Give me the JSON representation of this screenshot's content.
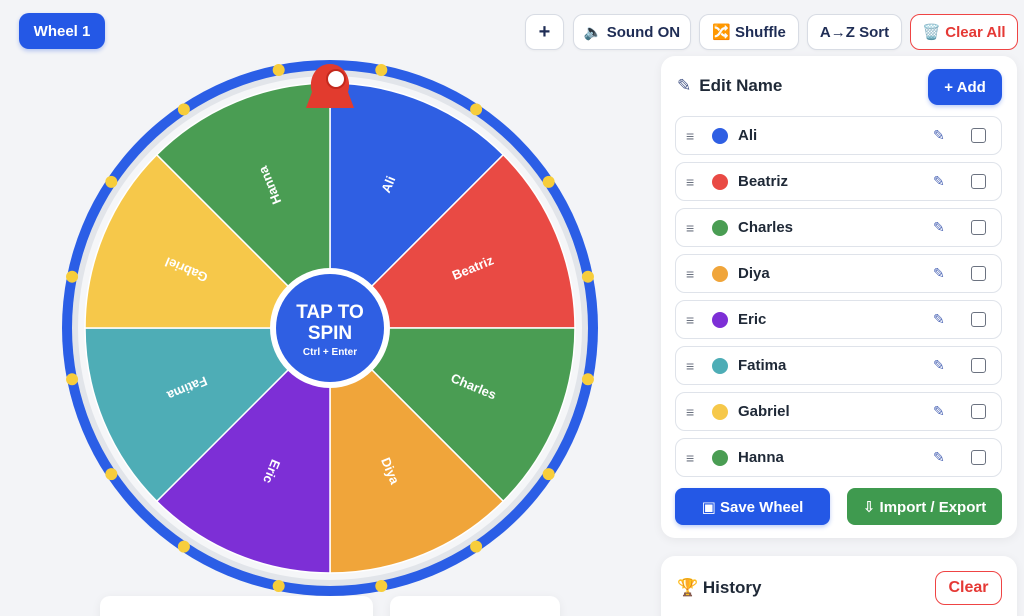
{
  "header": {
    "wheel_tab": "Wheel 1",
    "plus": "+",
    "sound": "🔈 Sound ON",
    "shuffle": "🔀 Shuffle",
    "sort": "A→Z Sort",
    "clear_all": "🗑️ Clear All"
  },
  "wheel": {
    "spin_title_1": "TAP TO",
    "spin_title_2": "SPIN",
    "spin_shortcut": "Ctrl + Enter",
    "segments": [
      {
        "label": "Ali",
        "color": "#2f5fe3"
      },
      {
        "label": "Beatriz",
        "color": "#e94a44"
      },
      {
        "label": "Charles",
        "color": "#4a9d53"
      },
      {
        "label": "Diya",
        "color": "#f0a53a"
      },
      {
        "label": "Eric",
        "color": "#7d2fd6"
      },
      {
        "label": "Fatima",
        "color": "#4eadb6"
      },
      {
        "label": "Gabriel",
        "color": "#f6c84a"
      },
      {
        "label": "Hanna",
        "color": "#4a9d53"
      }
    ],
    "rim_color": "#2b5ee6",
    "rim_dot_color": "#f7cd3b",
    "pointer_color": "#e23b2e"
  },
  "edit_panel": {
    "title": "Edit Name",
    "pencil_icon": "✎",
    "add_label": "+ Add",
    "rows": [
      {
        "name": "Ali",
        "color": "#2f5fe3"
      },
      {
        "name": "Beatriz",
        "color": "#e94a44"
      },
      {
        "name": "Charles",
        "color": "#4a9d53"
      },
      {
        "name": "Diya",
        "color": "#f0a53a"
      },
      {
        "name": "Eric",
        "color": "#7d2fd6"
      },
      {
        "name": "Fatima",
        "color": "#4eadb6"
      },
      {
        "name": "Gabriel",
        "color": "#f6c84a"
      },
      {
        "name": "Hanna",
        "color": "#4a9d53"
      }
    ],
    "drag_glyph": "≡",
    "edit_glyph": "✎",
    "save_label": "▣ Save Wheel",
    "import_label": "⇩ Import / Export"
  },
  "history": {
    "title": "🏆 History",
    "clear_label": "Clear"
  }
}
